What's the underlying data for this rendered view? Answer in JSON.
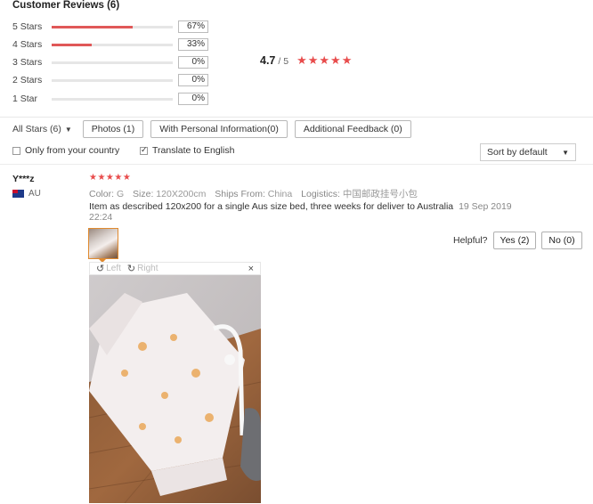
{
  "section": {
    "title": "Customer Reviews (6)"
  },
  "ratings": [
    {
      "label": "5 Stars",
      "pct_text": "67%",
      "fraction": 0.67
    },
    {
      "label": "4 Stars",
      "pct_text": "33%",
      "fraction": 0.33
    },
    {
      "label": "3 Stars",
      "pct_text": "0%",
      "fraction": 0
    },
    {
      "label": "2 Stars",
      "pct_text": "0%",
      "fraction": 0
    },
    {
      "label": "1 Star",
      "pct_text": "0%",
      "fraction": 0
    }
  ],
  "overall": {
    "avg": "4.7",
    "out_of": "/ 5",
    "stars": "★★★★★",
    "star_color": "#e84c4c"
  },
  "filters": {
    "all_stars": "All Stars (6)",
    "photos": "Photos (1)",
    "personal_info": "With Personal Information(0)",
    "additional": "Additional Feedback (0)",
    "only_country": "Only from your country",
    "translate": "Translate to English",
    "translate_checked": true,
    "only_country_checked": false,
    "sort": "Sort by default"
  },
  "review": {
    "user": "Y***z",
    "country": "AU",
    "stars": "★★★★★",
    "color_label": "Color:",
    "color_value": "G",
    "size_label": "Size:",
    "size_value": "120X200cm",
    "ships_label": "Ships From:",
    "ships_value": "China",
    "logistics_label": "Logistics:",
    "logistics_value": "中国邮政挂号小包",
    "text": "Item as described 120x200 for a single Aus size bed, three weeks for deliver to Australia",
    "date": "19 Sep 2019 22:24",
    "helpful_label": "Helpful?",
    "yes": "Yes (2)",
    "no": "No (0)"
  },
  "viewer": {
    "left": "Left",
    "right": "Right",
    "close": "×"
  },
  "colors": {
    "accent": "#e05858",
    "thumb_border": "#e08a2f"
  }
}
